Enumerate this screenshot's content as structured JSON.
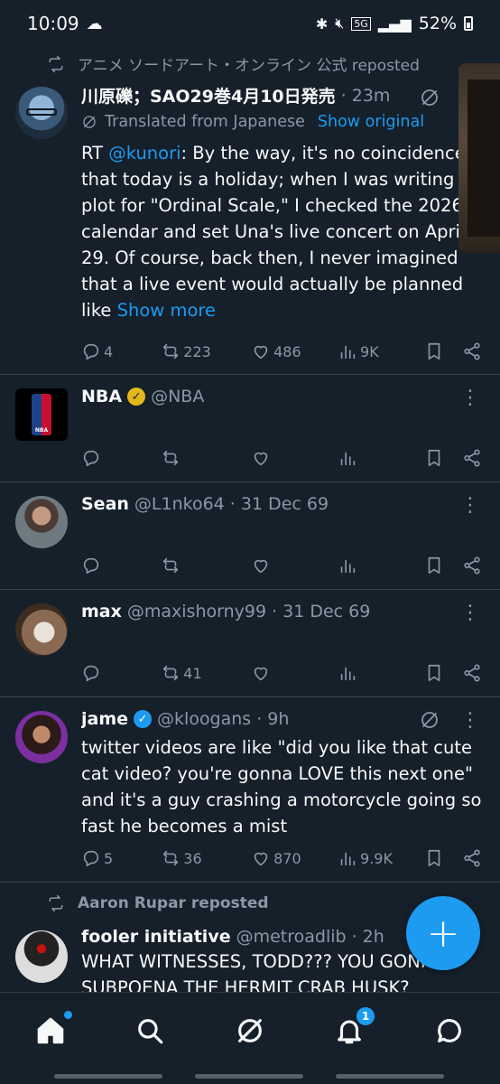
{
  "status_bar": {
    "time": "10:09",
    "network": "5G",
    "battery": "52%"
  },
  "tweets": [
    {
      "repost_by": "アニメ ソードアート・オンライン 公式 reposted",
      "name": "川原礫；SAO29巻4月10日発売",
      "time": "· 23m",
      "translated": "Translated from Japanese",
      "show_original": "Show original",
      "rt_prefix": "RT ",
      "mention": "@kunori",
      "text": ": By the way, it's no coincidence that today is a holiday; when I was writing the plot for \"Ordinal Scale,\" I checked the 2026 calendar and set Una's live concert on April 29. Of course, back then, I never imagined that a live event would actually be planned like ",
      "show_more": "Show more",
      "replies": "4",
      "reposts": "223",
      "likes": "486",
      "views": "9K"
    },
    {
      "name": "NBA",
      "handle": "@NBA",
      "verified": "gold",
      "avatar_text": "NBA",
      "replies": "",
      "reposts": "",
      "likes": "",
      "views": ""
    },
    {
      "name": "Sean",
      "handle": "@L1nko64",
      "time": "· 31 Dec 69",
      "replies": "",
      "reposts": "",
      "likes": "",
      "views": ""
    },
    {
      "name": "max",
      "handle": "@maxishorny99",
      "time": "· 31 Dec 69",
      "replies": "",
      "reposts": "41",
      "likes": "",
      "views": ""
    },
    {
      "name": "jame",
      "handle": "@kloogans",
      "time": "· 9h",
      "verified": "blue",
      "text": "twitter videos are like \"did you like that cute cat video? you're gonna LOVE this next one\" and it's a guy crashing a motorcycle going so fast he becomes a mist",
      "replies": "5",
      "reposts": "36",
      "likes": "870",
      "views": "9.9K"
    },
    {
      "repost_by": "Aaron Rupar reposted",
      "name": "fooler initiative",
      "handle": "@metroadlib",
      "time": "· 2h",
      "text": "WHAT WITNESSES, TODD??? YOU GONNA SUBPOENA THE HERMIT CRAB HUSK?"
    }
  ],
  "fab_label": "+",
  "nav": {
    "notifications_badge": "1"
  },
  "colors": {
    "background": "#15202b",
    "accent": "#1d9bf0",
    "muted": "#8b98a5",
    "verified_gold": "#e2b719"
  }
}
